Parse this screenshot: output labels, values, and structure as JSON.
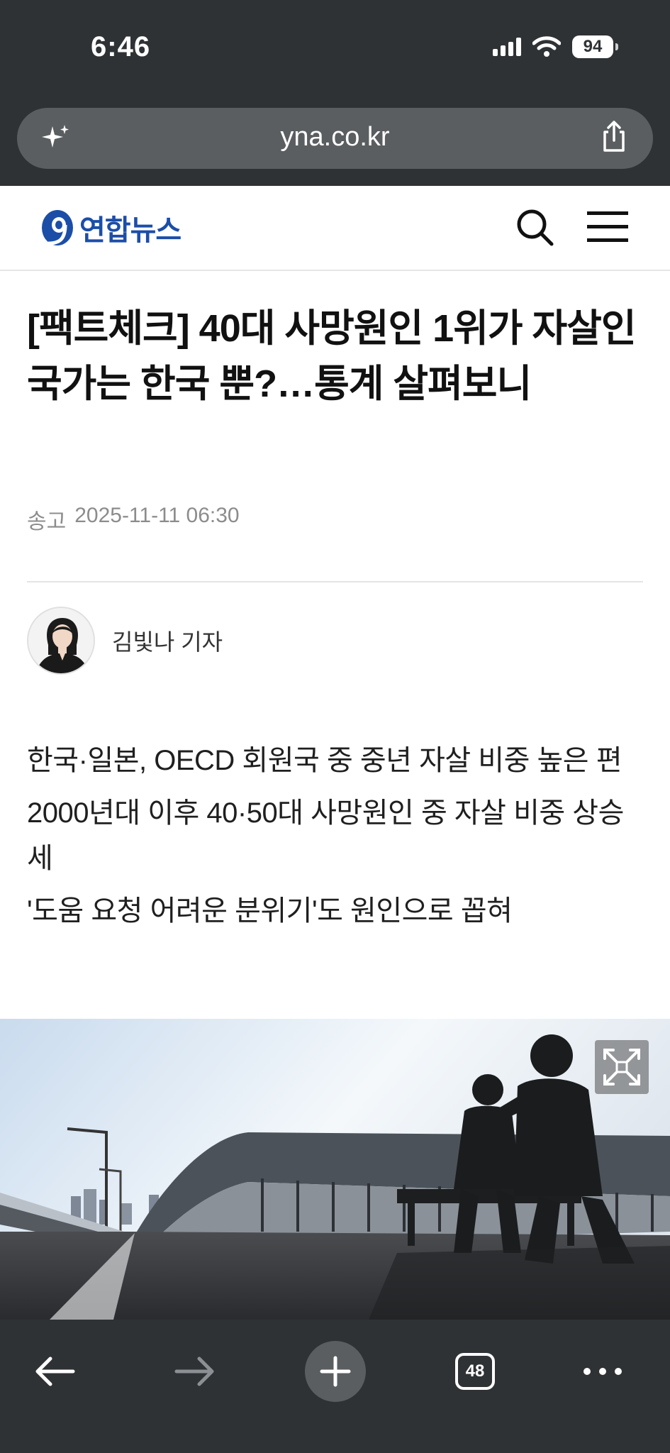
{
  "status": {
    "time": "6:46",
    "battery": "94"
  },
  "browser": {
    "url": "yna.co.kr",
    "tab_count": "48"
  },
  "site": {
    "logo_text": "연합뉴스",
    "brand_color": "#1c4ea8"
  },
  "article": {
    "headline": "[팩트체크] 40대 사망원인 1위가 자살인 국가는 한국 뿐?…통계 살펴보니",
    "meta_label": "송고",
    "published": "2025-11-11 06:30",
    "author": "김빛나 기자",
    "summary": [
      "한국·일본, OECD 회원국 중 중년 자살 비중 높은 편",
      "2000년대 이후 40·50대 사망원인 중 자살 비중 상승세",
      "'도움 요청 어려운 분위기'도 원인으로 꼽혀"
    ]
  },
  "icons": {
    "urlbar_left": "sparkle-icon",
    "urlbar_right": "share-icon",
    "header_search": "search-icon",
    "header_menu": "hamburger-menu-icon",
    "image_expand": "expand-icon",
    "toolbar": [
      "back-arrow-icon",
      "forward-arrow-icon",
      "new-tab-plus-icon",
      "tabs-icon",
      "more-icon"
    ]
  }
}
